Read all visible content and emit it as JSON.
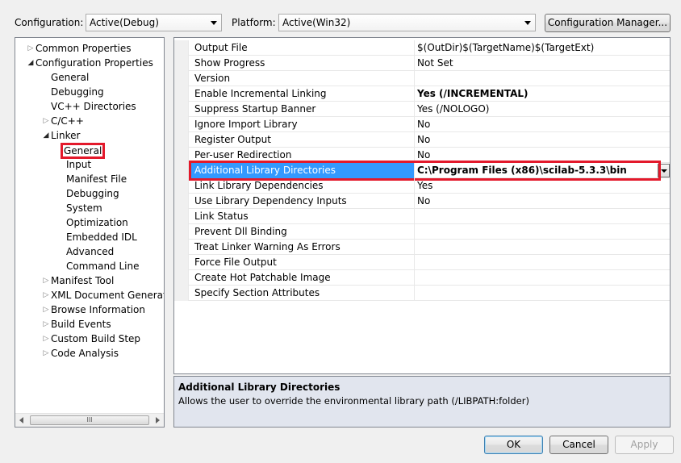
{
  "toolbar": {
    "configuration_label": "Configuration:",
    "configuration_value": "Active(Debug)",
    "platform_label": "Platform:",
    "platform_value": "Active(Win32)",
    "config_manager_button": "Configuration Manager..."
  },
  "tree": {
    "items": [
      {
        "label": "Common Properties",
        "level": 0,
        "expander": "collapsed"
      },
      {
        "label": "Configuration Properties",
        "level": 0,
        "expander": "expanded"
      },
      {
        "label": "General",
        "level": 1,
        "expander": "none"
      },
      {
        "label": "Debugging",
        "level": 1,
        "expander": "none"
      },
      {
        "label": "VC++ Directories",
        "level": 1,
        "expander": "none"
      },
      {
        "label": "C/C++",
        "level": 1,
        "expander": "collapsed"
      },
      {
        "label": "Linker",
        "level": 1,
        "expander": "expanded"
      },
      {
        "label": "General",
        "level": 2,
        "expander": "none",
        "selected": true
      },
      {
        "label": "Input",
        "level": 2,
        "expander": "none"
      },
      {
        "label": "Manifest File",
        "level": 2,
        "expander": "none"
      },
      {
        "label": "Debugging",
        "level": 2,
        "expander": "none"
      },
      {
        "label": "System",
        "level": 2,
        "expander": "none"
      },
      {
        "label": "Optimization",
        "level": 2,
        "expander": "none"
      },
      {
        "label": "Embedded IDL",
        "level": 2,
        "expander": "none"
      },
      {
        "label": "Advanced",
        "level": 2,
        "expander": "none"
      },
      {
        "label": "Command Line",
        "level": 2,
        "expander": "none"
      },
      {
        "label": "Manifest Tool",
        "level": 1,
        "expander": "collapsed"
      },
      {
        "label": "XML Document Generator",
        "level": 1,
        "expander": "collapsed"
      },
      {
        "label": "Browse Information",
        "level": 1,
        "expander": "collapsed"
      },
      {
        "label": "Build Events",
        "level": 1,
        "expander": "collapsed"
      },
      {
        "label": "Custom Build Step",
        "level": 1,
        "expander": "collapsed"
      },
      {
        "label": "Code Analysis",
        "level": 1,
        "expander": "collapsed"
      }
    ],
    "scroll_grip": "III"
  },
  "grid": {
    "rows": [
      {
        "name": "Output File",
        "value": "$(OutDir)$(TargetName)$(TargetExt)"
      },
      {
        "name": "Show Progress",
        "value": "Not Set"
      },
      {
        "name": "Version",
        "value": ""
      },
      {
        "name": "Enable Incremental Linking",
        "value": "Yes (/INCREMENTAL)",
        "bold": true
      },
      {
        "name": "Suppress Startup Banner",
        "value": "Yes (/NOLOGO)"
      },
      {
        "name": "Ignore Import Library",
        "value": "No"
      },
      {
        "name": "Register Output",
        "value": "No"
      },
      {
        "name": "Per-user Redirection",
        "value": "No"
      },
      {
        "name": "Additional Library Directories",
        "value": "C:\\Program Files (x86)\\scilab-5.3.3\\bin",
        "selected": true
      },
      {
        "name": "Link Library Dependencies",
        "value": "Yes"
      },
      {
        "name": "Use Library Dependency Inputs",
        "value": "No"
      },
      {
        "name": "Link Status",
        "value": ""
      },
      {
        "name": "Prevent Dll Binding",
        "value": ""
      },
      {
        "name": "Treat Linker Warning As Errors",
        "value": ""
      },
      {
        "name": "Force File Output",
        "value": ""
      },
      {
        "name": "Create Hot Patchable Image",
        "value": ""
      },
      {
        "name": "Specify Section Attributes",
        "value": ""
      }
    ]
  },
  "description": {
    "title": "Additional Library Directories",
    "text": "Allows the user to override the environmental library path (/LIBPATH:folder)"
  },
  "buttons": {
    "ok": "OK",
    "cancel": "Cancel",
    "apply": "Apply"
  },
  "colors": {
    "selection": "#3399ff",
    "highlight_box": "#e3192b",
    "description_bg": "#e1e5ee"
  }
}
